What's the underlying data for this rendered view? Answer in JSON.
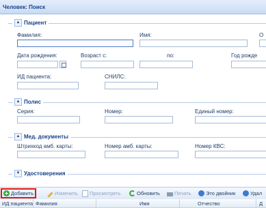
{
  "window": {
    "title": "Человек: Поиск"
  },
  "patient": {
    "legend": "Пациент",
    "surname_label": "Фамилия:",
    "name_label": "Имя:",
    "patronymic_label": "О",
    "dob_label": "Дата рождения:",
    "age_from_label": "Возраст с:",
    "age_to_label": "по:",
    "birth_year_label": "Год рожде",
    "patient_id_label": "ИД пациента:",
    "snils_label": "СНИЛС:",
    "surname_value": "",
    "name_value": ""
  },
  "policy": {
    "legend": "Полис",
    "series_label": "Серия:",
    "number_label": "Номер:",
    "unified_number_label": "Единый номер:"
  },
  "med_docs": {
    "legend": "Мед. документы",
    "barcode_label": "Штрихкод амб. карты:",
    "card_number_label": "Номер амб. карты:",
    "kvs_number_label": "Номер КВС:"
  },
  "identity_docs": {
    "legend": "Удостоверения"
  },
  "toolbar": {
    "add": "Добавить",
    "edit": "Изменить",
    "view": "Просмотреть",
    "refresh": "Обновить",
    "print": "Печать",
    "duplicate": "Это двойник",
    "delete": "Удал"
  },
  "grid": {
    "columns": [
      "ИД пациента",
      "Фамилия",
      "Имя",
      "Отчество",
      "Д"
    ]
  },
  "icons": {
    "collapse": "chevron-up-icon",
    "expand": "chevron-down-icon",
    "calendar": "calendar-icon",
    "add": "add-circle-icon",
    "edit": "pencil-icon",
    "view": "document-icon",
    "refresh": "refresh-icon",
    "print": "printer-icon",
    "duplicate": "info-circle-icon",
    "delete": "delete-circle-icon"
  },
  "colors": {
    "highlight": "#e0161a",
    "accent": "#15428b"
  }
}
